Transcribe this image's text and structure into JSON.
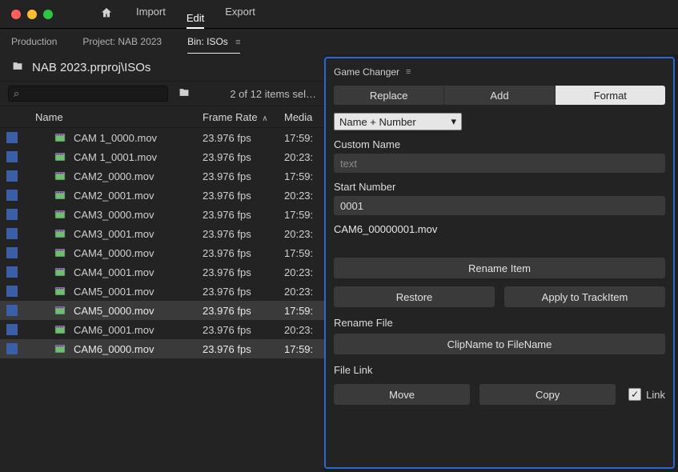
{
  "menu": {
    "import": "Import",
    "edit": "Edit",
    "export": "Export"
  },
  "tabs": {
    "production": "Production",
    "project": "Project: NAB 2023",
    "bin": "Bin: ISOs"
  },
  "path": "NAB 2023.prproj\\ISOs",
  "items_count": "2 of 12 items sel…",
  "columns": {
    "name": "Name",
    "frame_rate": "Frame Rate",
    "media": "Media"
  },
  "rows": [
    {
      "name": "CAM 1_0000.mov",
      "fr": "23.976 fps",
      "m": "17:59:",
      "sel": false
    },
    {
      "name": "CAM 1_0001.mov",
      "fr": "23.976 fps",
      "m": "20:23:",
      "sel": false
    },
    {
      "name": "CAM2_0000.mov",
      "fr": "23.976 fps",
      "m": "17:59:",
      "sel": false
    },
    {
      "name": "CAM2_0001.mov",
      "fr": "23.976 fps",
      "m": "20:23:",
      "sel": false
    },
    {
      "name": "CAM3_0000.mov",
      "fr": "23.976 fps",
      "m": "17:59:",
      "sel": false
    },
    {
      "name": "CAM3_0001.mov",
      "fr": "23.976 fps",
      "m": "20:23:",
      "sel": false
    },
    {
      "name": "CAM4_0000.mov",
      "fr": "23.976 fps",
      "m": "17:59:",
      "sel": false
    },
    {
      "name": "CAM4_0001.mov",
      "fr": "23.976 fps",
      "m": "20:23:",
      "sel": false
    },
    {
      "name": "CAM5_0001.mov",
      "fr": "23.976 fps",
      "m": "20:23:",
      "sel": false
    },
    {
      "name": "CAM5_0000.mov",
      "fr": "23.976 fps",
      "m": "17:59:",
      "sel": true
    },
    {
      "name": "CAM6_0001.mov",
      "fr": "23.976 fps",
      "m": "20:23:",
      "sel": false
    },
    {
      "name": "CAM6_0000.mov",
      "fr": "23.976 fps",
      "m": "17:59:",
      "sel": true
    }
  ],
  "panel": {
    "title": "Game Changer",
    "tabs": {
      "replace": "Replace",
      "add": "Add",
      "format": "Format"
    },
    "format_mode": "Name + Number",
    "custom_name_label": "Custom Name",
    "custom_name_placeholder": "text",
    "start_number_label": "Start Number",
    "start_number_value": "0001",
    "preview": "CAM6_00000001.mov",
    "rename_item": "Rename Item",
    "restore": "Restore",
    "apply_trackitem": "Apply to TrackItem",
    "rename_file_label": "Rename File",
    "clipname_to_filename": "ClipName to FileName",
    "file_link_label": "File Link",
    "move": "Move",
    "copy": "Copy",
    "link_label": "Link",
    "link_checked": true
  }
}
